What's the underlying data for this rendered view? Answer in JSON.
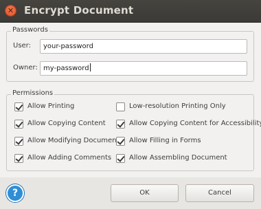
{
  "window": {
    "title": "Encrypt Document"
  },
  "passwords": {
    "legend": "Passwords",
    "user_label": "User:",
    "user_value": "your-password",
    "owner_label": "Owner:",
    "owner_value": "my-password"
  },
  "permissions": {
    "legend": "Permissions",
    "items": [
      {
        "label": "Allow Printing",
        "checked": true
      },
      {
        "label": "Low-resolution Printing Only",
        "checked": false
      },
      {
        "label": "Allow Copying Content",
        "checked": true
      },
      {
        "label": "Allow Copying Content for Accessibility",
        "checked": true
      },
      {
        "label": "Allow Modifying Document",
        "checked": true
      },
      {
        "label": "Allow Filling in Forms",
        "checked": true
      },
      {
        "label": "Allow Adding Comments",
        "checked": true
      },
      {
        "label": "Allow Assembling Document",
        "checked": true
      }
    ]
  },
  "footer": {
    "help_glyph": "?",
    "ok_label": "OK",
    "cancel_label": "Cancel"
  },
  "icons": {
    "close": "close-icon",
    "help": "help-icon"
  },
  "colors": {
    "titlebar": "#3f3e3a",
    "close_button": "#e8582c",
    "help_button": "#2f8ed6"
  }
}
